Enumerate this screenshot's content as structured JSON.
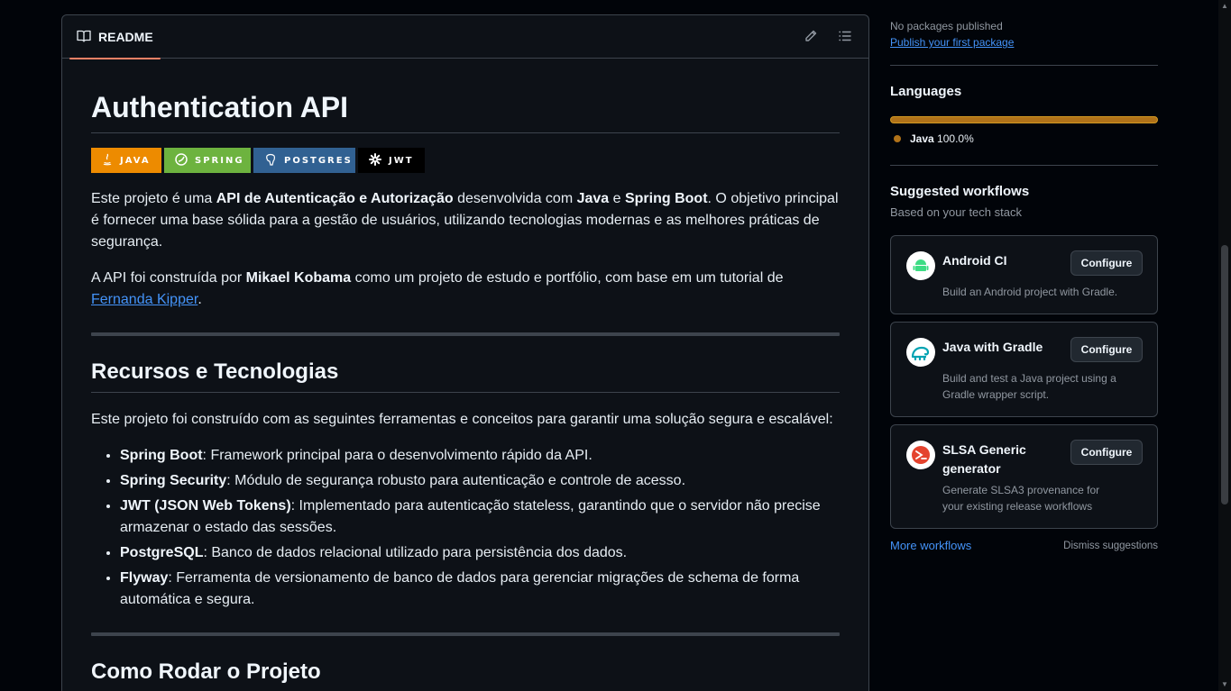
{
  "readme": {
    "tab_label": "README",
    "title": "Authentication API",
    "badges": [
      "JAVA",
      "SPRING",
      "POSTGRES",
      "JWT"
    ],
    "intro": {
      "t1": "Este projeto é uma ",
      "b1": "API de Autenticação e Autorização",
      "t2": " desenvolvida com ",
      "b2": "Java",
      "t3": " e ",
      "b3": "Spring Boot",
      "t4": ". O objetivo principal é fornecer uma base sólida para a gestão de usuários, utilizando tecnologias modernas e as melhores práticas de segurança."
    },
    "credits": {
      "t1": "A API foi construída por ",
      "b1": "Mikael Kobama",
      "t2": " como um projeto de estudo e portfólio, com base em um tutorial de ",
      "link": "Fernanda Kipper",
      "t3": "."
    },
    "section1_title": "Recursos e Tecnologias",
    "section1_intro": "Este projeto foi construído com as seguintes ferramentas e conceitos para garantir uma solução segura e escalável:",
    "features": [
      {
        "name": "Spring Boot",
        "desc": ": Framework principal para o desenvolvimento rápido da API."
      },
      {
        "name": "Spring Security",
        "desc": ": Módulo de segurança robusto para autenticação e controle de acesso."
      },
      {
        "name": "JWT (JSON Web Tokens)",
        "desc": ": Implementado para autenticação stateless, garantindo que o servidor não precise armazenar o estado das sessões."
      },
      {
        "name": "PostgreSQL",
        "desc": ": Banco de dados relacional utilizado para persistência dos dados."
      },
      {
        "name": "Flyway",
        "desc": ": Ferramenta de versionamento de banco de dados para gerenciar migrações de schema de forma automática e segura."
      }
    ],
    "section2_title": "Como Rodar o Projeto"
  },
  "sidebar": {
    "packages_text": "No packages published",
    "packages_link": "Publish your first package",
    "languages_title": "Languages",
    "language_name": "Java",
    "language_percent": "100.0%",
    "language_fraction": 1.0,
    "language_color": "#b07219",
    "workflows_title": "Suggested workflows",
    "workflows_subtitle": "Based on your tech stack",
    "workflows": [
      {
        "title": "Android CI",
        "desc": "Build an Android project with Gradle.",
        "button": "Configure",
        "icon": "android-icon"
      },
      {
        "title": "Java with Gradle",
        "desc": "Build and test a Java project using a Gradle wrapper script.",
        "button": "Configure",
        "icon": "gradle-icon"
      },
      {
        "title": "SLSA Generic generator",
        "desc": "Generate SLSA3 provenance for your existing release workflows",
        "button": "Configure",
        "icon": "slsa-icon"
      }
    ],
    "more_workflows": "More workflows",
    "dismiss": "Dismiss suggestions"
  }
}
